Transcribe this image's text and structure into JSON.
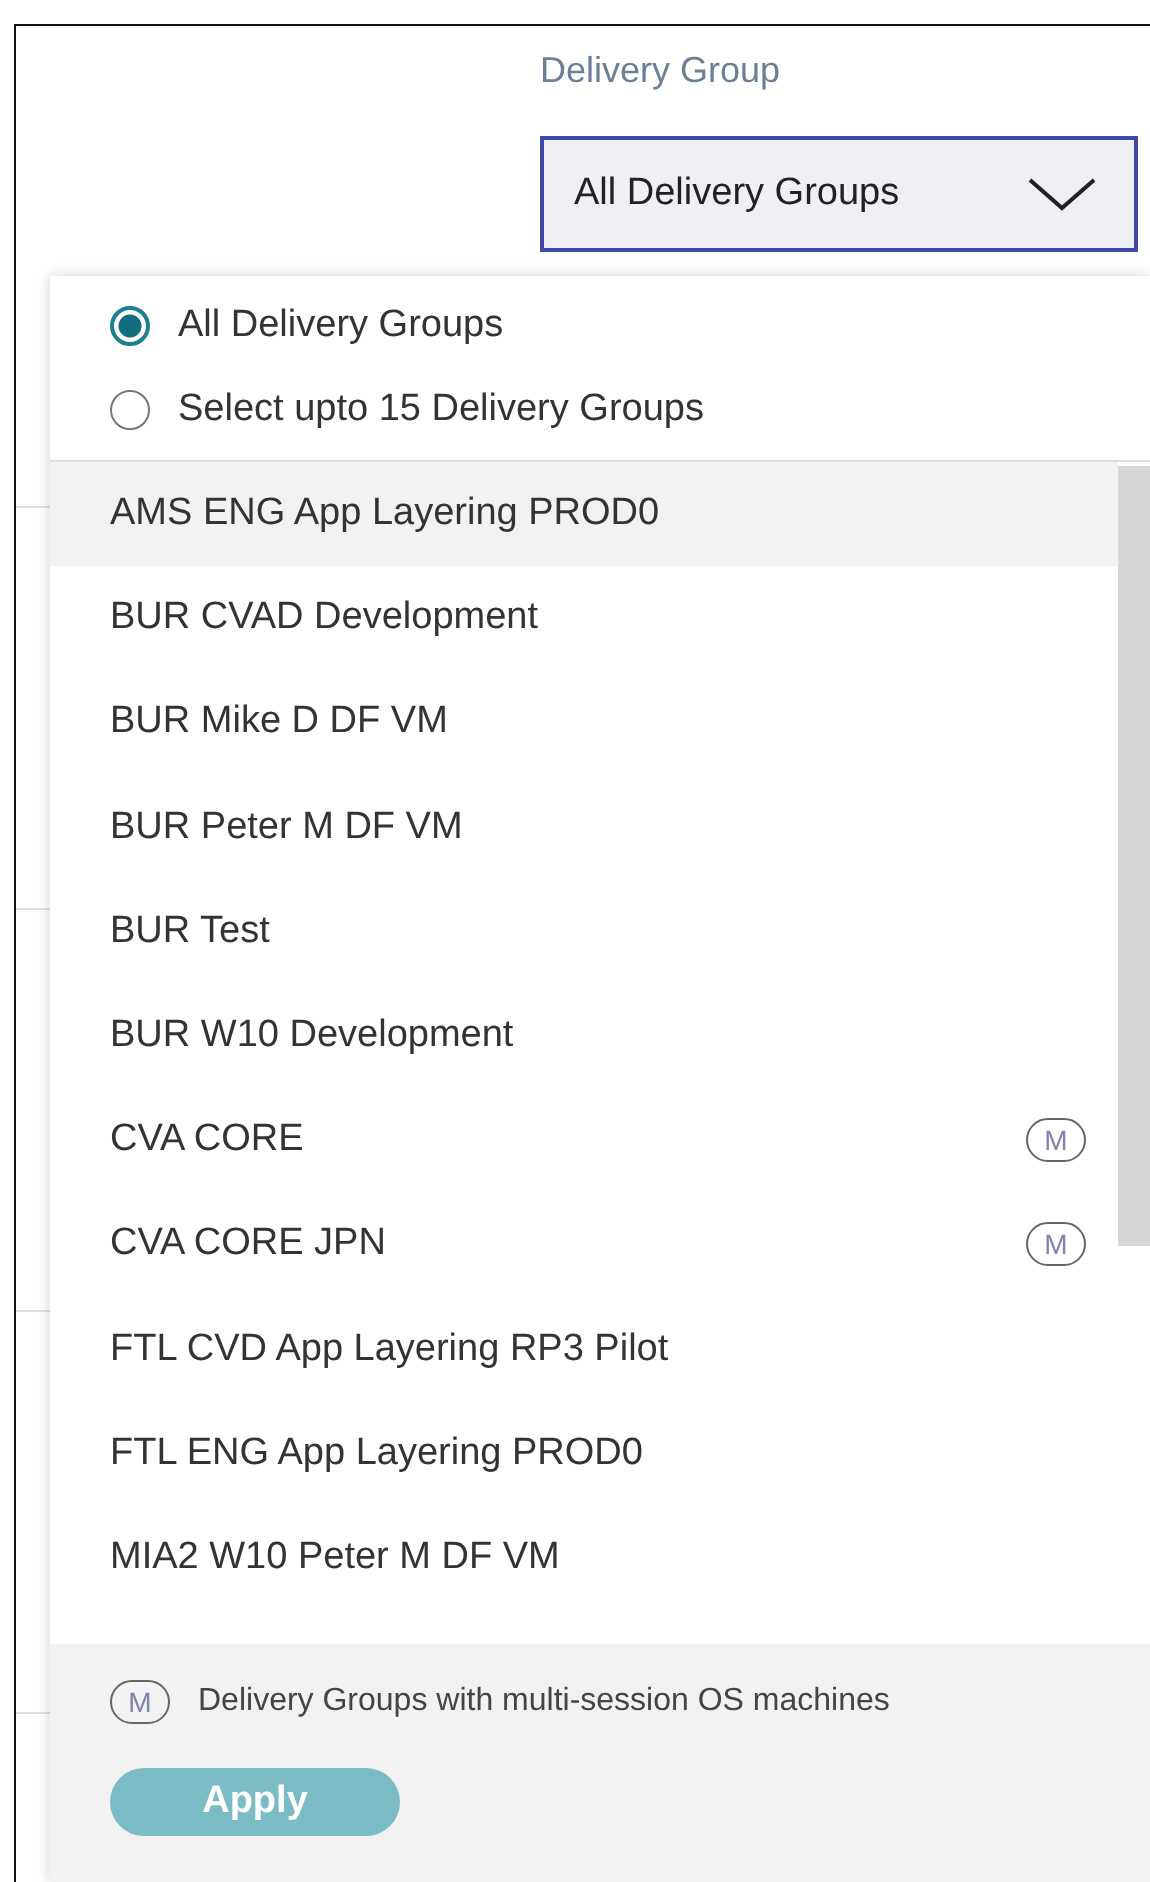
{
  "filter_label": "Delivery Group",
  "dropdown": {
    "value": "All Delivery Groups",
    "open": true
  },
  "options": [
    {
      "label": "All Delivery Groups",
      "selected": true
    },
    {
      "label": "Select upto 15 Delivery Groups",
      "selected": false
    }
  ],
  "groups": [
    {
      "name": "AMS ENG App Layering PROD0",
      "highlighted": true,
      "multi_session": false
    },
    {
      "name": "BUR CVAD Development",
      "highlighted": false,
      "multi_session": false
    },
    {
      "name": "BUR Mike D DF VM",
      "highlighted": false,
      "multi_session": false
    },
    {
      "name": "BUR Peter M DF VM",
      "highlighted": false,
      "multi_session": false
    },
    {
      "name": "BUR Test",
      "highlighted": false,
      "multi_session": false
    },
    {
      "name": "BUR W10 Development",
      "highlighted": false,
      "multi_session": false
    },
    {
      "name": "CVA CORE",
      "highlighted": false,
      "multi_session": true,
      "badge": "M"
    },
    {
      "name": "CVA CORE JPN",
      "highlighted": false,
      "multi_session": true,
      "badge": "M"
    },
    {
      "name": "FTL CVD App Layering RP3 Pilot",
      "highlighted": false,
      "multi_session": false
    },
    {
      "name": "FTL ENG App Layering PROD0",
      "highlighted": false,
      "multi_session": false
    },
    {
      "name": "MIA2 W10 Peter M DF VM",
      "highlighted": false,
      "multi_session": false
    }
  ],
  "legend": {
    "badge": "M",
    "text": "Delivery Groups with multi-session OS machines"
  },
  "apply_button": {
    "label": "Apply",
    "disabled": true
  }
}
